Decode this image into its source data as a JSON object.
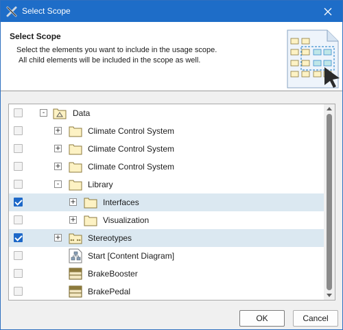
{
  "window": {
    "title": "Select Scope"
  },
  "header": {
    "title": "Select Scope",
    "description_line1": "Select the elements you want to include in the usage scope.",
    "description_line2": "All child elements will be included in the scope as well."
  },
  "tree": {
    "rows": [
      {
        "label": "Data",
        "checked": false,
        "expander": "-",
        "icon": "package-icon",
        "selected": false
      },
      {
        "label": "Climate Control System",
        "checked": false,
        "expander": "+",
        "icon": "folder-icon",
        "selected": false
      },
      {
        "label": "Climate Control System",
        "checked": false,
        "expander": "+",
        "icon": "folder-icon",
        "selected": false
      },
      {
        "label": "Climate Control System",
        "checked": false,
        "expander": "+",
        "icon": "folder-icon",
        "selected": false
      },
      {
        "label": "Library",
        "checked": false,
        "expander": "-",
        "icon": "folder-icon",
        "selected": false
      },
      {
        "label": "Interfaces",
        "checked": true,
        "expander": "+",
        "icon": "folder-icon",
        "selected": true
      },
      {
        "label": "Visualization",
        "checked": false,
        "expander": "+",
        "icon": "folder-icon",
        "selected": false
      },
      {
        "label": "Stereotypes",
        "checked": true,
        "expander": "+",
        "icon": "stereotype-folder-icon",
        "selected": true
      },
      {
        "label": "Start [Content Diagram]",
        "checked": false,
        "expander": "",
        "icon": "content-diagram-icon",
        "selected": false
      },
      {
        "label": "BrakeBooster",
        "checked": false,
        "expander": "",
        "icon": "block-icon",
        "selected": false
      },
      {
        "label": "BrakePedal",
        "checked": false,
        "expander": "",
        "icon": "block-icon",
        "selected": false
      }
    ]
  },
  "buttons": {
    "ok": "OK",
    "cancel": "Cancel"
  },
  "colors": {
    "titlebar": "#1e6dc8",
    "checkbox_checked": "#1d68c8",
    "selected_row": "#dbe8f1",
    "folder_fill": "#fdf2c4",
    "folder_stroke": "#8c7a3c"
  }
}
